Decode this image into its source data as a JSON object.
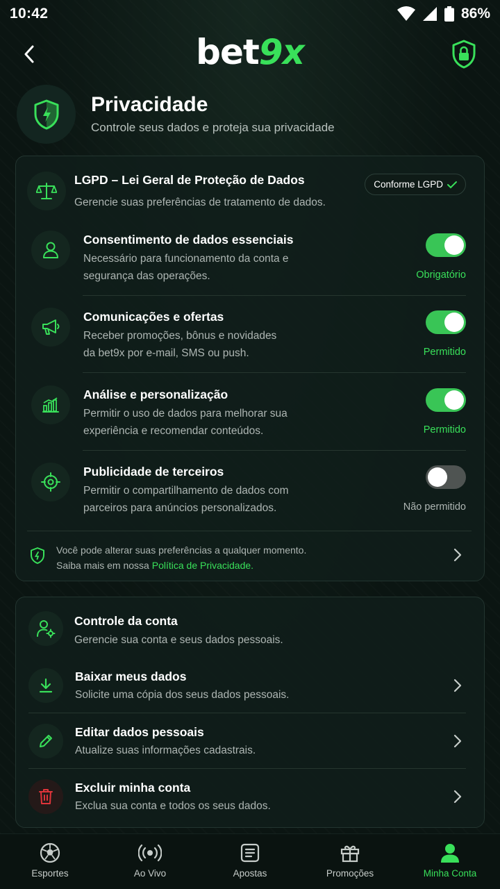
{
  "status_bar": {
    "time": "10:42",
    "battery": "86%"
  },
  "header": {
    "logo_part1": "bet",
    "logo_part2": "9x"
  },
  "page": {
    "title": "Privacidade",
    "subtitle": "Controle seus dados e proteja sua privacidade"
  },
  "lgpd": {
    "title": "LGPD – Lei Geral de Proteção de Dados",
    "description": "Gerencie suas preferências de tratamento de dados.",
    "badge": "Conforme LGPD",
    "settings": [
      {
        "title": "Consentimento de dados essenciais",
        "desc1": "Necessário para funcionamento da conta e",
        "desc2": "segurança das operações.",
        "enabled": true,
        "status": "Obrigatório"
      },
      {
        "title": "Comunicações e ofertas",
        "desc1": "Receber promoções, bônus e novidades",
        "desc2": "da bet9x por e-mail, SMS ou push.",
        "enabled": true,
        "status": "Permitido"
      },
      {
        "title": "Análise e personalização",
        "desc1": "Permitir o uso de dados para melhorar sua",
        "desc2": "experiência e recomendar conteúdos.",
        "enabled": true,
        "status": "Permitido"
      },
      {
        "title": "Publicidade de terceiros",
        "desc1": "Permitir o compartilhamento de dados com",
        "desc2": "parceiros para anúncios personalizados.",
        "enabled": false,
        "status": "Não permitido"
      }
    ],
    "footer_line1": "Você pode alterar suas preferências a qualquer momento.",
    "footer_line2_prefix": "Saiba mais em nossa ",
    "footer_link": "Política de Privacidade."
  },
  "account": {
    "title": "Controle da conta",
    "description": "Gerencie sua conta e seus dados pessoais.",
    "items": [
      {
        "title": "Baixar meus dados",
        "desc": "Solicite uma cópia dos seus dados pessoais."
      },
      {
        "title": "Editar dados pessoais",
        "desc": "Atualize suas informações cadastrais."
      },
      {
        "title": "Excluir minha conta",
        "desc": "Exclua sua conta e todos os seus dados."
      }
    ]
  },
  "nav": [
    {
      "label": "Esportes",
      "icon": "soccer-ball-icon"
    },
    {
      "label": "Ao Vivo",
      "icon": "live-icon"
    },
    {
      "label": "Apostas",
      "icon": "bets-icon"
    },
    {
      "label": "Promoções",
      "icon": "gift-icon"
    },
    {
      "label": "Minha Conta",
      "icon": "user-icon",
      "active": true
    }
  ],
  "colors": {
    "accent": "#39e05a",
    "background": "#0b1512",
    "card": "#101e1a",
    "danger": "#e0343a"
  }
}
